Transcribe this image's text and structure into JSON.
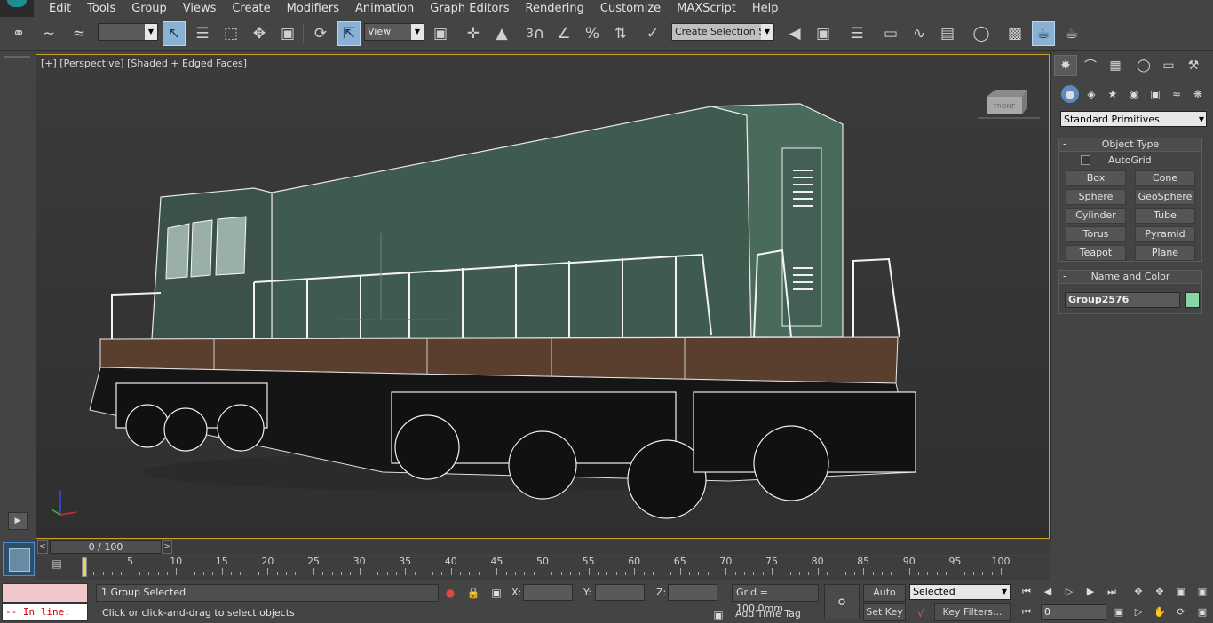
{
  "menu": {
    "items": [
      "Edit",
      "Tools",
      "Group",
      "Views",
      "Create",
      "Modifiers",
      "Animation",
      "Graph Editors",
      "Rendering",
      "Customize",
      "MAXScript",
      "Help"
    ]
  },
  "toolbar": {
    "view_dropdown": "View",
    "selection_set": "Create Selection Se",
    "snap_number": "3"
  },
  "viewport": {
    "label": "[+] [Perspective] [Shaded + Edged Faces]",
    "viewcube_text": "FRONT"
  },
  "command_panel": {
    "dropdown": "Standard Primitives",
    "object_type": {
      "title": "Object Type",
      "autogrid": "AutoGrid",
      "buttons": [
        "Box",
        "Cone",
        "Sphere",
        "GeoSphere",
        "Cylinder",
        "Tube",
        "Torus",
        "Pyramid",
        "Teapot",
        "Plane"
      ]
    },
    "name_color": {
      "title": "Name and Color",
      "name": "Group2576",
      "color": "#86d6a6"
    }
  },
  "time_slider": {
    "position": "0 / 100",
    "ticks": [
      "5",
      "10",
      "15",
      "20",
      "25",
      "30",
      "35",
      "40",
      "45",
      "50",
      "55",
      "60",
      "65",
      "70",
      "75",
      "80",
      "85",
      "90",
      "95",
      "100"
    ]
  },
  "status": {
    "script_line": "-- In line:",
    "selection": "1 Group Selected",
    "prompt": "Click or click-and-drag to select objects",
    "x_label": "X:",
    "y_label": "Y:",
    "z_label": "Z:",
    "grid": "Grid = 100,0mm",
    "add_time_tag": "Add Time Tag",
    "auto_key": "Auto Key",
    "set_key": "Set Key",
    "selected_dropdown": "Selected",
    "key_filters": "Key Filters...",
    "frame": "0"
  },
  "colors": {
    "viewport_border": "#c9a227",
    "locomotive_body": "#3f5a4e",
    "frame_wood": "#5a3f2f"
  }
}
